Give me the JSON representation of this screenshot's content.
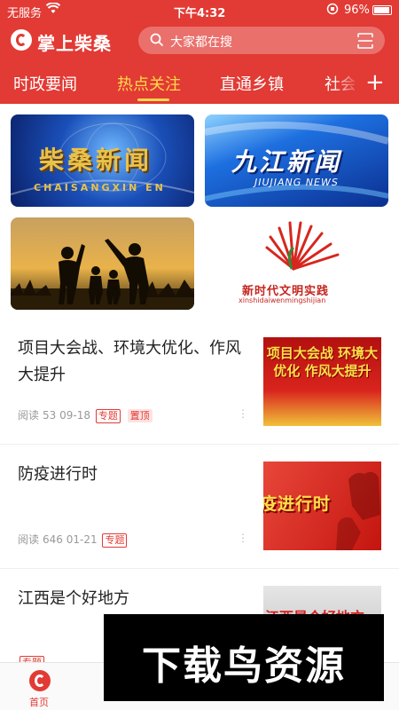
{
  "status_bar": {
    "carrier": "无服务",
    "time": "下午4:32",
    "battery": "96%"
  },
  "header": {
    "app_name": "掌上柴桑",
    "search_placeholder": "大家都在搜"
  },
  "tabs": [
    {
      "label": "时政要闻",
      "active": false
    },
    {
      "label": "热点关注",
      "active": true
    },
    {
      "label": "直通乡镇",
      "active": false
    },
    {
      "label": "社会",
      "active": false
    }
  ],
  "banners": [
    {
      "title": "柴桑新闻",
      "subtitle": "CHAISANGXIN EN"
    },
    {
      "title": "九江新闻",
      "subtitle": "JIUJIANG NEWS"
    },
    {
      "title": ""
    },
    {
      "title": "新时代文明实践",
      "subtitle": "xinshidaiwenmingshijian"
    }
  ],
  "news": [
    {
      "title": "项目大会战、环境大优化、作风大提升",
      "read_label": "阅读",
      "reads": "53",
      "date": "09-18",
      "tag": "专题",
      "pin": "置顶",
      "thumb_text": "项目大会战 环境大优化 作风大提升"
    },
    {
      "title": "防疫进行时",
      "read_label": "阅读",
      "reads": "646",
      "date": "01-21",
      "tag": "专题",
      "thumb_text": "疫进行时"
    },
    {
      "title": "江西是个好地方",
      "read_label": "",
      "reads": "",
      "date": "",
      "tag": "专题",
      "thumb_text": "江西是个好地方"
    }
  ],
  "bottom_nav": [
    {
      "label": "首页",
      "active": true
    },
    {
      "label": "",
      "active": false
    },
    {
      "label": "",
      "active": false
    },
    {
      "label": "",
      "active": false
    },
    {
      "label": "",
      "active": false
    }
  ],
  "watermark": "下载鸟资源",
  "colors": {
    "brand_red": "#e23a34",
    "active_tab": "#ffd84d"
  }
}
